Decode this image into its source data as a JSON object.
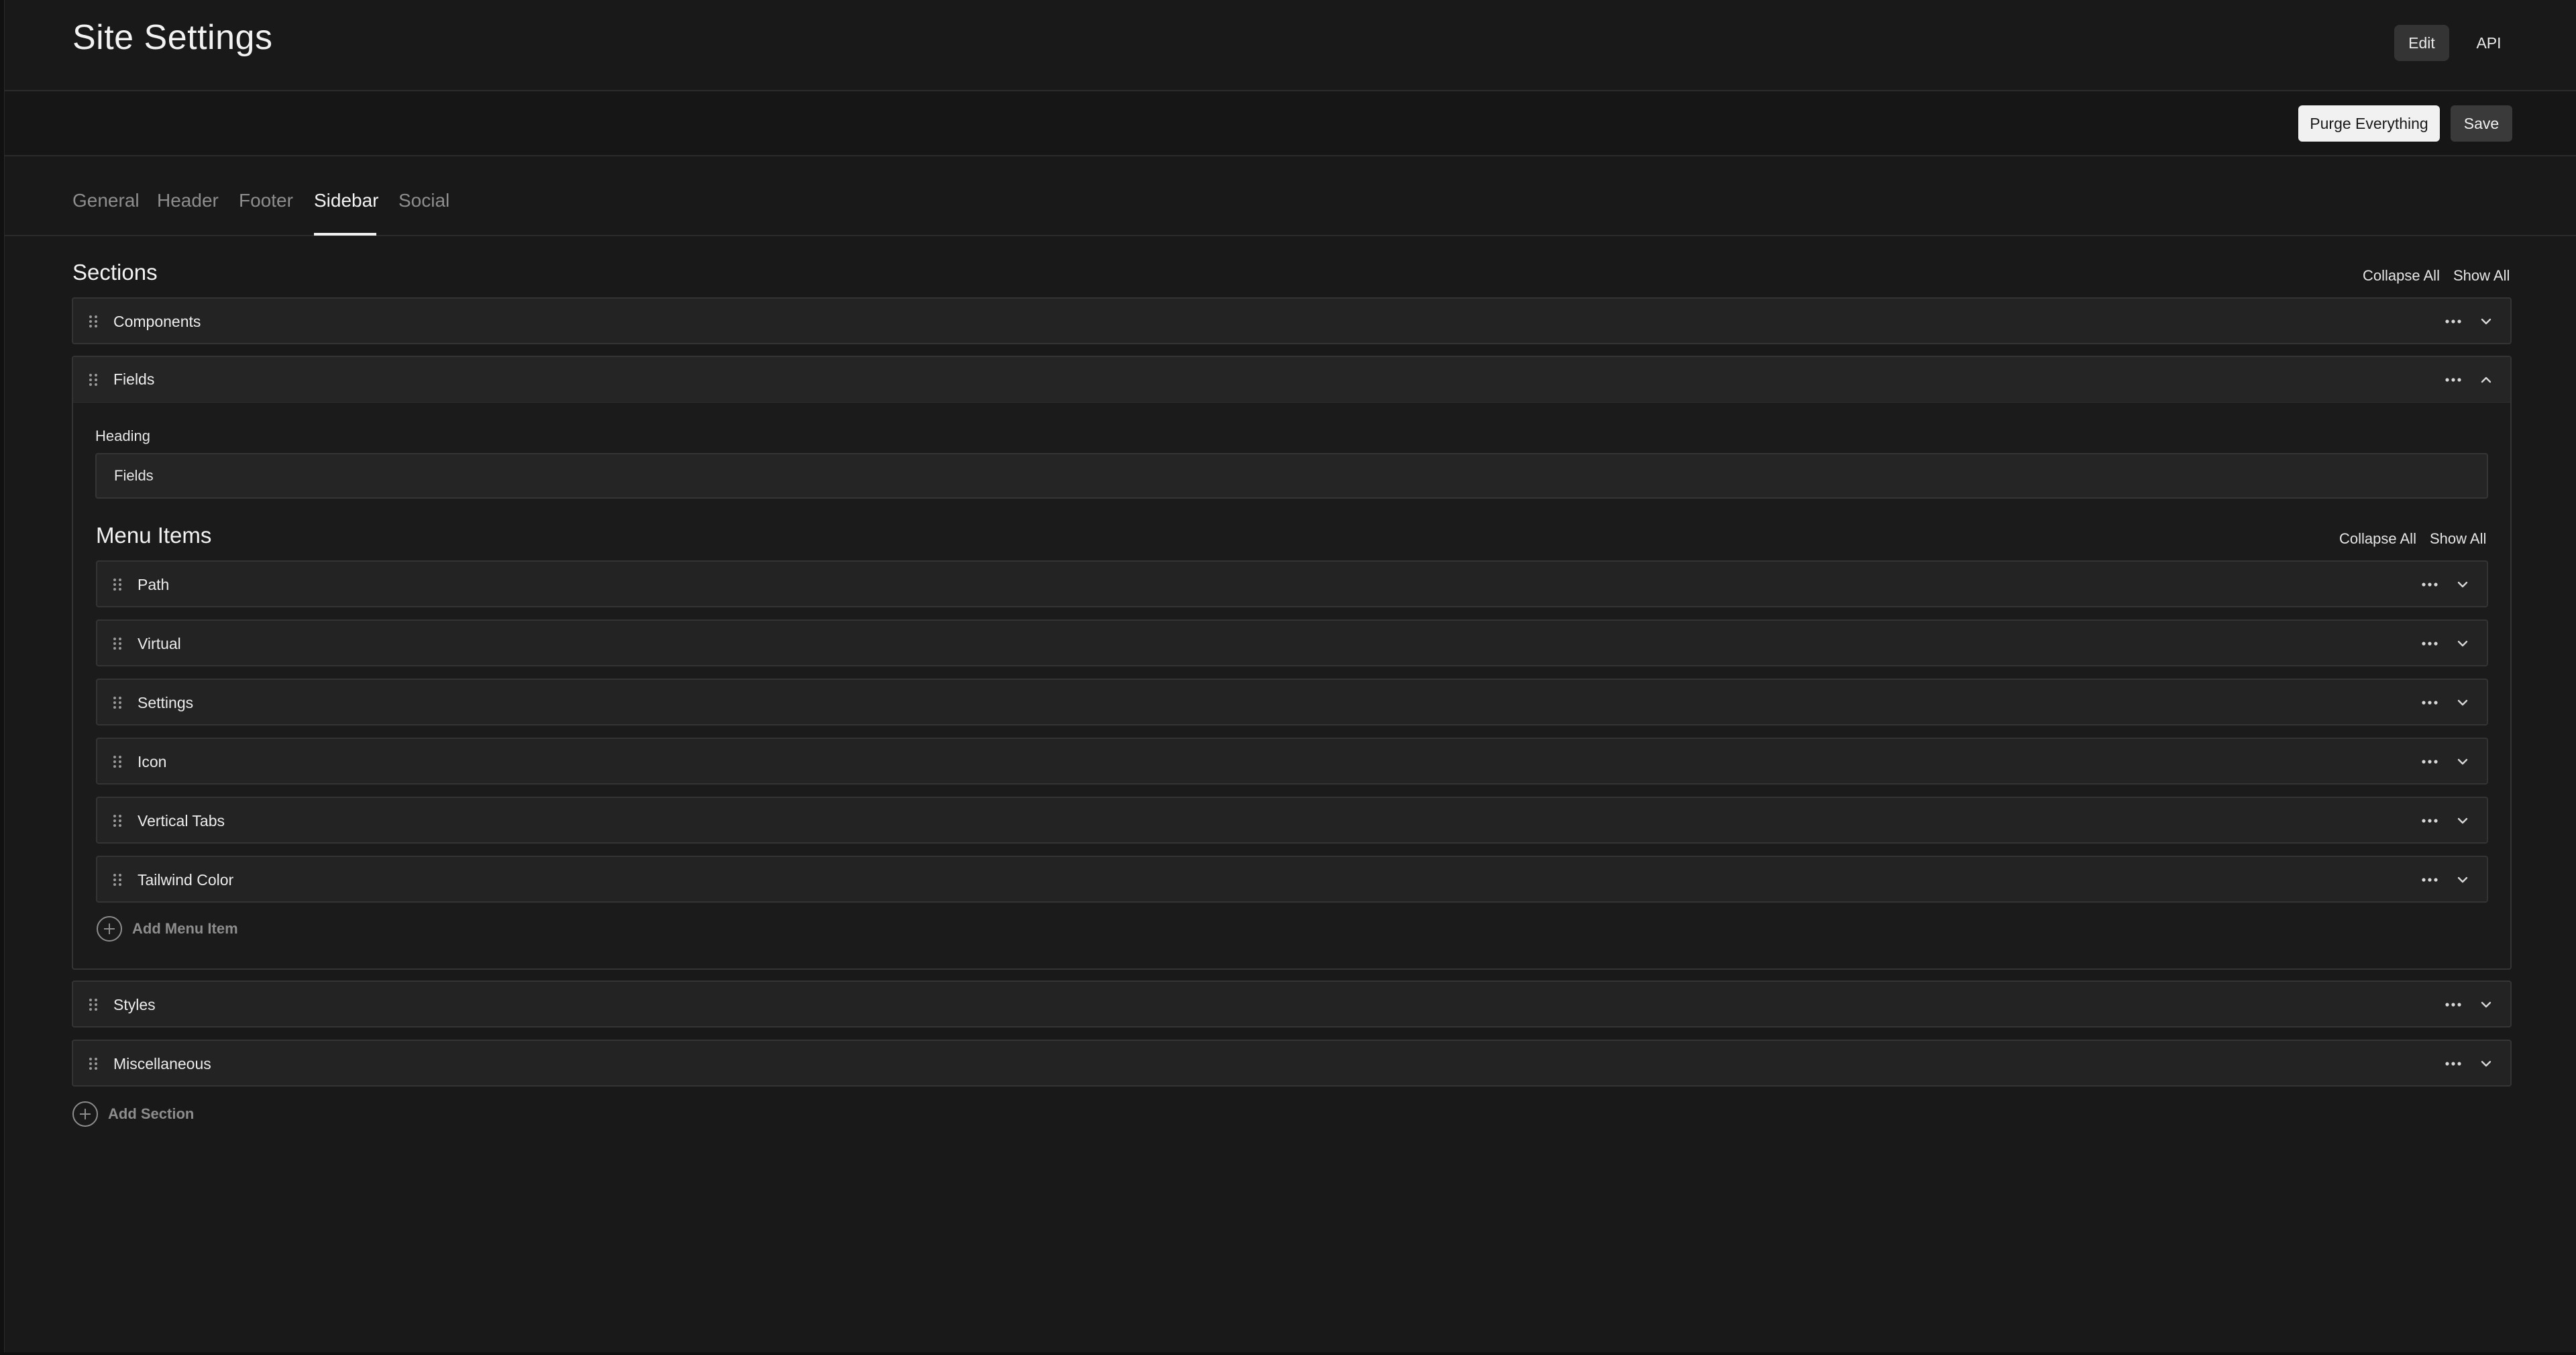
{
  "header": {
    "title": "Site Settings",
    "view_buttons": [
      {
        "label": "Edit",
        "active": true
      },
      {
        "label": "API",
        "active": false
      }
    ]
  },
  "toolbar": {
    "purge_label": "Purge Everything",
    "save_label": "Save"
  },
  "tabs": [
    {
      "label": "General",
      "active": false
    },
    {
      "label": "Header",
      "active": false
    },
    {
      "label": "Footer",
      "active": false
    },
    {
      "label": "Sidebar",
      "active": true
    },
    {
      "label": "Social",
      "active": false
    }
  ],
  "sections": {
    "title": "Sections",
    "collapse_all": "Collapse All",
    "show_all": "Show All",
    "items": [
      {
        "label": "Components",
        "expanded": false
      },
      {
        "label": "Fields",
        "expanded": true
      },
      {
        "label": "Styles",
        "expanded": false
      },
      {
        "label": "Miscellaneous",
        "expanded": false
      }
    ],
    "add_label": "Add Section"
  },
  "fields_section": {
    "heading_label": "Heading",
    "heading_value": "Fields",
    "menu_items": {
      "title": "Menu Items",
      "collapse_all": "Collapse All",
      "show_all": "Show All",
      "items": [
        {
          "label": "Path"
        },
        {
          "label": "Virtual"
        },
        {
          "label": "Settings"
        },
        {
          "label": "Icon"
        },
        {
          "label": "Vertical Tabs"
        },
        {
          "label": "Tailwind Color"
        }
      ],
      "add_label": "Add Menu Item"
    }
  },
  "icons": {
    "grip": "grip-vertical-icon",
    "more": "more-horizontal-icon",
    "chevron_down": "chevron-down-icon",
    "chevron_up": "chevron-up-icon",
    "plus": "plus-circle-icon"
  },
  "colors": {
    "background": "#191919",
    "panel": "#232323",
    "border": "#343434",
    "primary_button": "#f1f1f1",
    "muted_text": "#8e8e8e"
  }
}
